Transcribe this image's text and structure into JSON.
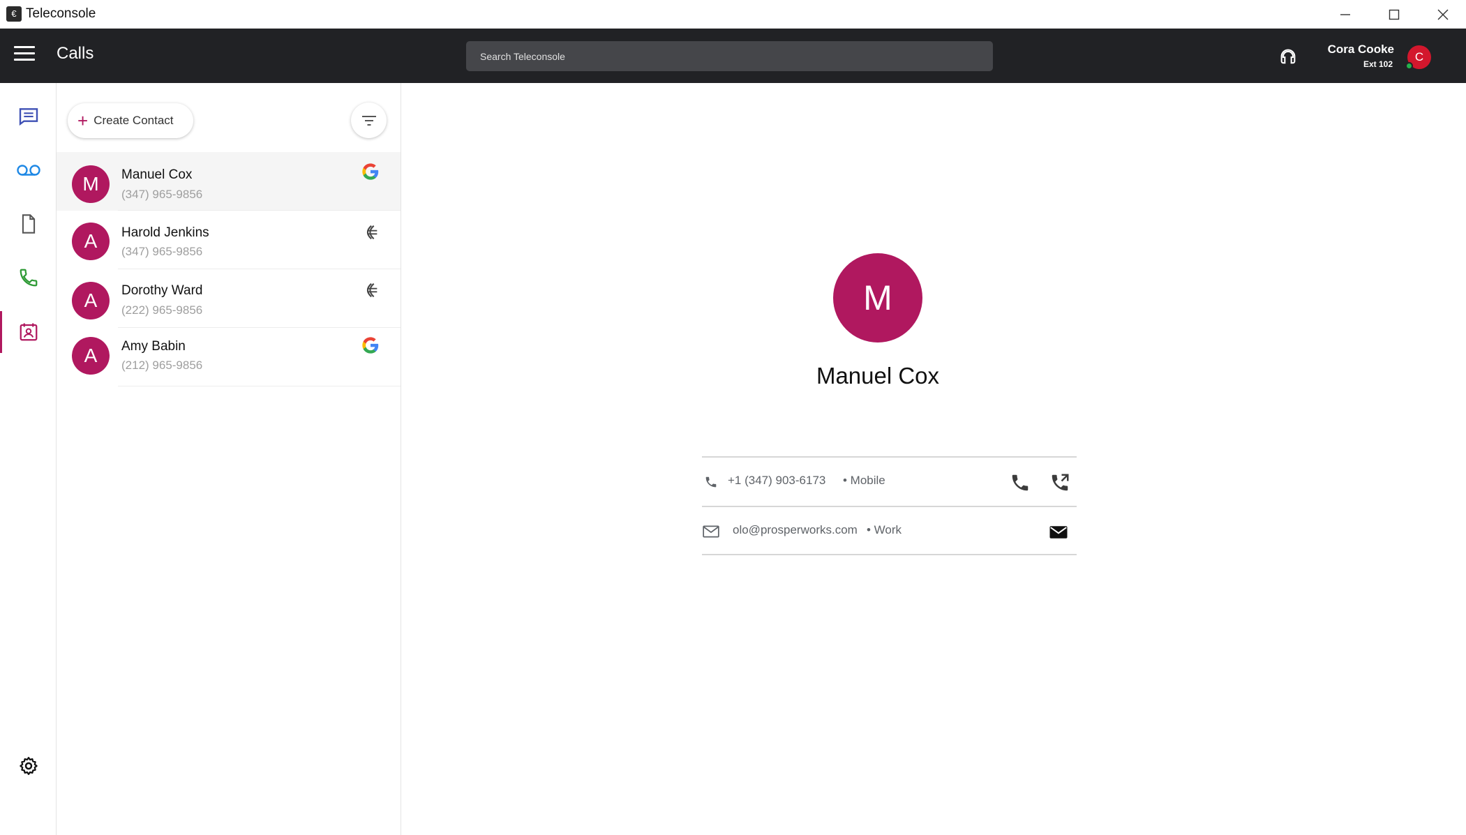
{
  "window": {
    "title": "Teleconsole"
  },
  "appbar": {
    "page_title": "Calls",
    "search_placeholder": "Search Teleconsole",
    "user": {
      "name": "Cora Cooke",
      "ext": "Ext 102",
      "initial": "C",
      "status_color": "#23b14d"
    }
  },
  "nav": {
    "items": [
      "messages-icon",
      "voicemail-icon",
      "document-icon",
      "phone-icon",
      "contacts-icon"
    ],
    "active": "contacts-icon",
    "settings": "settings-icon"
  },
  "list": {
    "create_label": "Create Contact",
    "contacts": [
      {
        "initial": "M",
        "name": "Manuel Cox",
        "phone": "(347) 965-9856",
        "source": "google-icon"
      },
      {
        "initial": "A",
        "name": "Harold Jenkins",
        "phone": "(347) 965-9856",
        "source": "teleconsole-icon"
      },
      {
        "initial": "A",
        "name": "Dorothy Ward",
        "phone": "(222) 965-9856",
        "source": "teleconsole-icon"
      },
      {
        "initial": "A",
        "name": "Amy Babin",
        "phone": "(212) 965-9856",
        "source": "google-icon"
      }
    ]
  },
  "detail": {
    "initial": "M",
    "name": "Manuel Cox",
    "phone": {
      "number": "+1 (347) 903-6173",
      "type": "• Mobile"
    },
    "email": {
      "address": "olo@prosperworks.com",
      "type": "• Work"
    }
  },
  "colors": {
    "accent": "#b0185f",
    "appbar": "#212225",
    "user_avatar": "#d3172d"
  }
}
